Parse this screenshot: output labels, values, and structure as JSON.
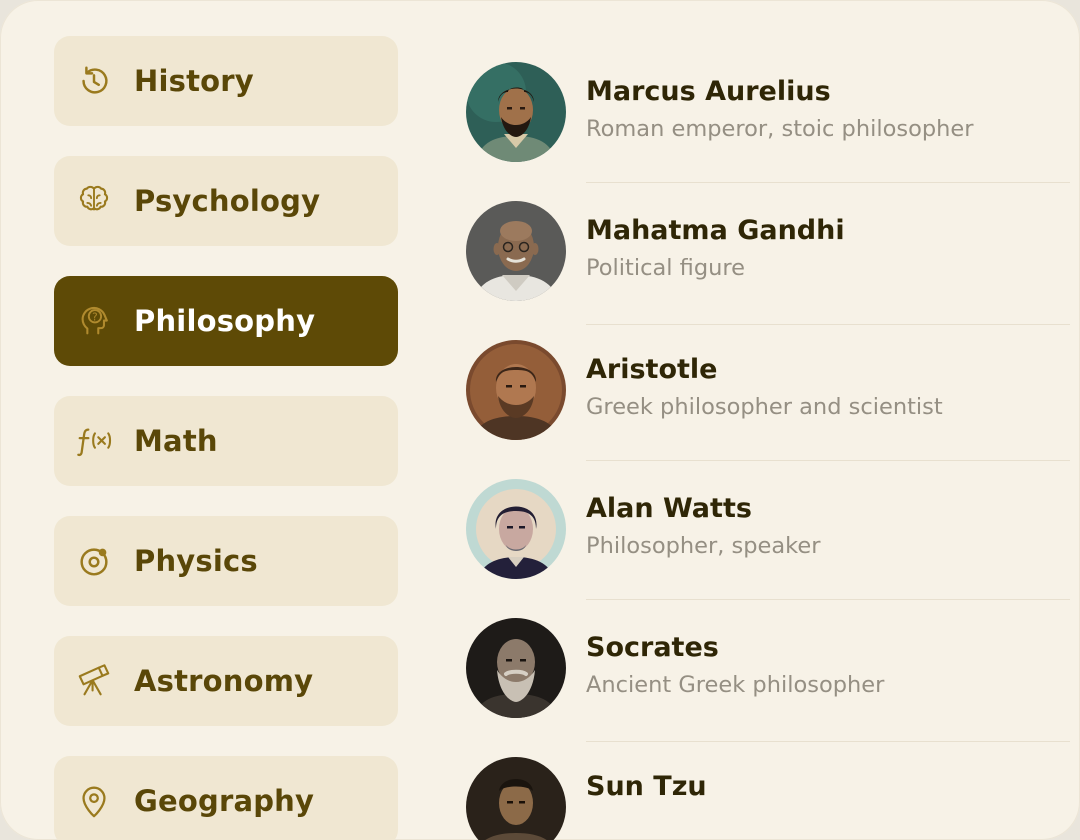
{
  "categories": [
    {
      "label": "History",
      "icon": "history-icon",
      "active": false
    },
    {
      "label": "Psychology",
      "icon": "brain-icon",
      "active": false
    },
    {
      "label": "Philosophy",
      "icon": "head-question-icon",
      "active": true
    },
    {
      "label": "Math",
      "icon": "function-icon",
      "active": false
    },
    {
      "label": "Physics",
      "icon": "orbit-icon",
      "active": false
    },
    {
      "label": "Astronomy",
      "icon": "telescope-icon",
      "active": false
    },
    {
      "label": "Geography",
      "icon": "map-pin-icon",
      "active": false
    }
  ],
  "people": [
    {
      "name": "Marcus Aurelius",
      "description": "Roman emperor, stoic philosopher"
    },
    {
      "name": "Mahatma Gandhi",
      "description": "Political figure"
    },
    {
      "name": "Aristotle",
      "description": "Greek philosopher and scientist"
    },
    {
      "name": "Alan Watts",
      "description": "Philosopher, speaker"
    },
    {
      "name": "Socrates",
      "description": "Ancient Greek philosopher"
    },
    {
      "name": "Sun Tzu",
      "description": ""
    }
  ],
  "colors": {
    "background": "#f7f2e7",
    "category_bg": "#f0e7d2",
    "accent": "#5e4a06",
    "category_text": "#5a4708",
    "icon": "#9a7a1e",
    "name_text": "#2f2606",
    "description_text": "#958f83"
  }
}
